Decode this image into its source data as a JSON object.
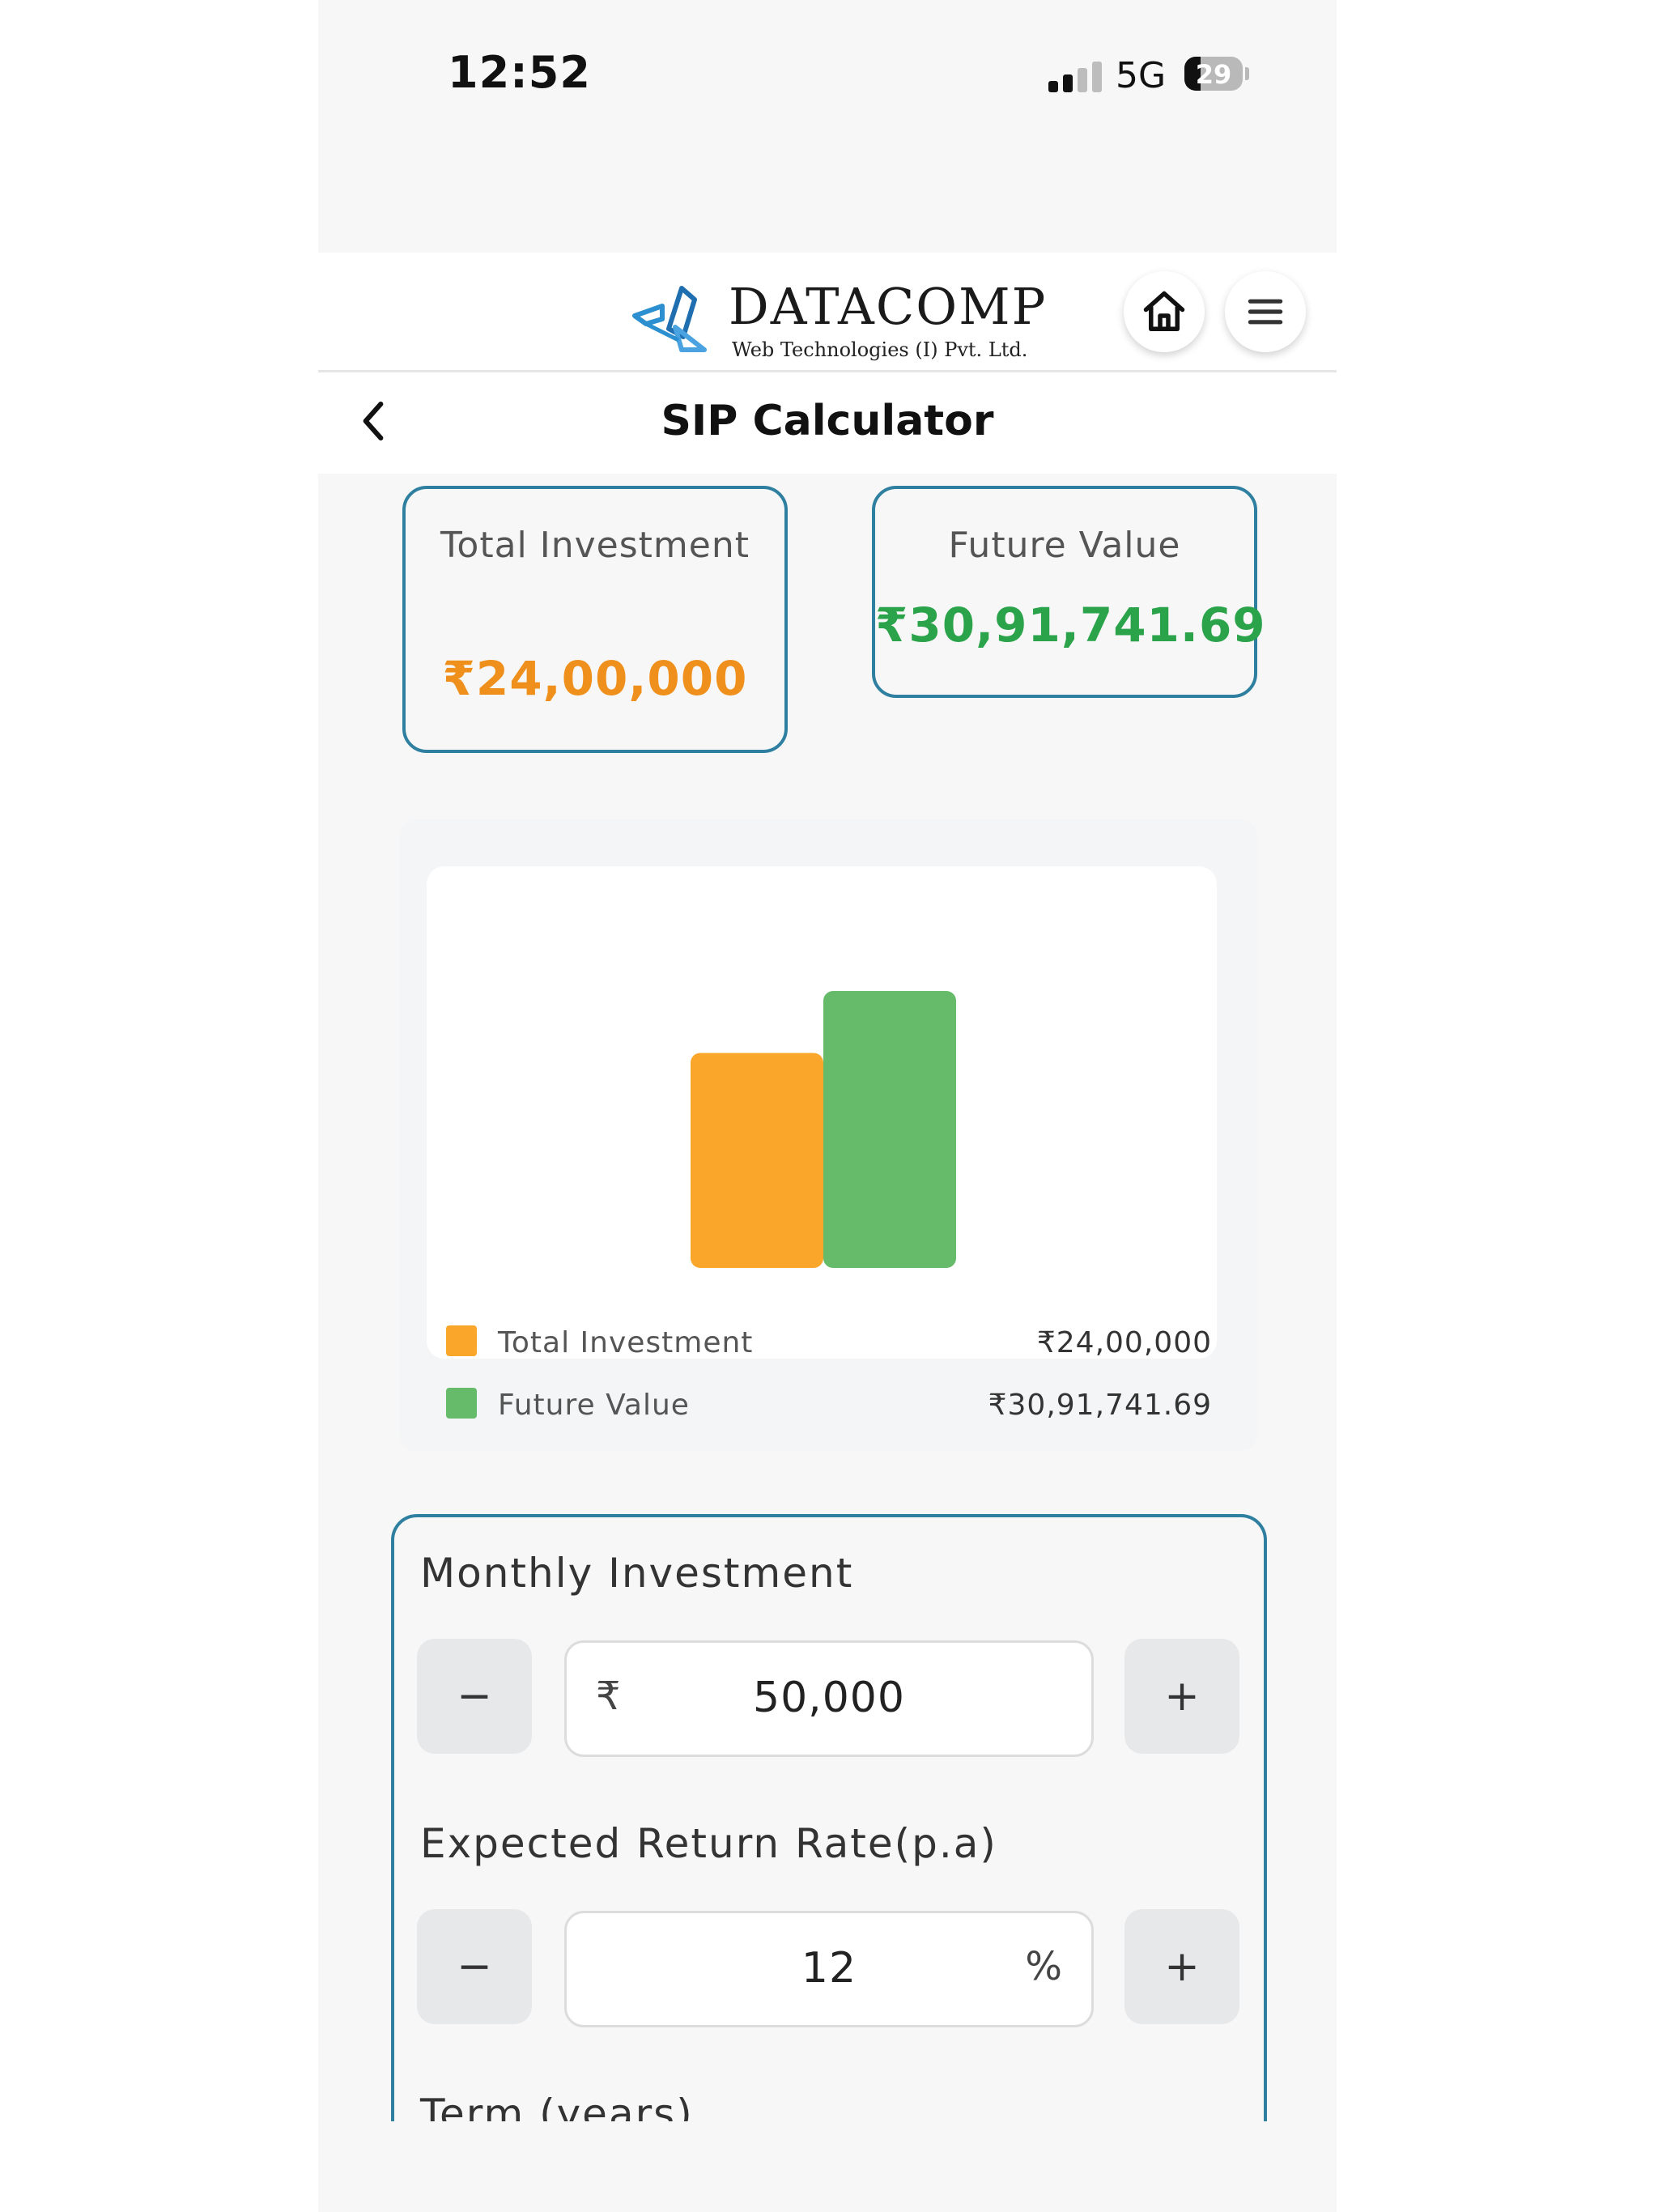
{
  "status_bar": {
    "time": "12:52",
    "network": "5G",
    "battery": "29"
  },
  "header": {
    "logo_title": "DATACOMP",
    "logo_subtitle": "Web Technologies (I) Pvt. Ltd."
  },
  "page": {
    "title": "SIP Calculator"
  },
  "summary": {
    "total_investment_label": "Total Investment",
    "total_investment_value": "₹24,00,000",
    "future_value_label": "Future Value",
    "future_value_value": "₹30,91,741.69"
  },
  "chart_data": {
    "type": "bar",
    "categories": [
      "Total Investment",
      "Future Value"
    ],
    "values": [
      2400000,
      3091741.69
    ],
    "colors": [
      "#f9a62b",
      "#66bb6a"
    ],
    "legend": [
      {
        "label": "Total Investment",
        "value": "₹24,00,000",
        "color": "#f9a62b"
      },
      {
        "label": "Future Value",
        "value": "₹30,91,741.69",
        "color": "#66bb6a"
      }
    ],
    "legend_position": "bottom"
  },
  "form": {
    "monthly_investment": {
      "label": "Monthly Investment",
      "currency": "₹",
      "value": "50,000",
      "minus": "−",
      "plus": "+"
    },
    "return_rate": {
      "label": "Expected Return Rate(p.a)",
      "value": "12",
      "unit": "%",
      "minus": "−",
      "plus": "+"
    },
    "term": {
      "label": "Term (years)"
    }
  },
  "icons": {
    "home": "home-icon",
    "menu": "hamburger-menu-icon",
    "back": "chevron-left-icon"
  },
  "colors": {
    "accent_border": "#2e7fa0",
    "total_investment": "#f0901c",
    "future_value": "#2aa34a"
  }
}
